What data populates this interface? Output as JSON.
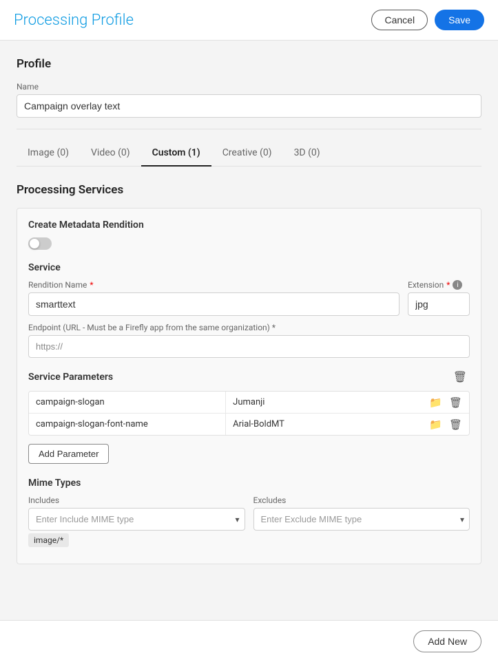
{
  "header": {
    "title_plain": "Processing",
    "title_accent": " Profile",
    "cancel_label": "Cancel",
    "save_label": "Save"
  },
  "profile_section": {
    "section_label": "Profile",
    "name_label": "Name",
    "name_value": "Campaign overlay text"
  },
  "tabs": [
    {
      "label": "Image (0)",
      "active": false
    },
    {
      "label": "Video (0)",
      "active": false
    },
    {
      "label": "Custom (1)",
      "active": true
    },
    {
      "label": "Creative (0)",
      "active": false
    },
    {
      "label": "3D (0)",
      "active": false
    }
  ],
  "processing_services": {
    "section_label": "Processing Services",
    "card_title": "Create Metadata Rendition",
    "service_label": "Service",
    "rendition_name_label": "Rendition Name",
    "rendition_name_required": "*",
    "rendition_name_value": "smarttext",
    "extension_label": "Extension",
    "extension_required": "*",
    "extension_value": "jpg",
    "endpoint_label": "Endpoint (URL - Must be a Firefly app from the same organization) *",
    "endpoint_value": "https://",
    "endpoint_placeholder": "https://",
    "params_title": "Service Parameters",
    "params": [
      {
        "key": "campaign-slogan",
        "value": "Jumanji"
      },
      {
        "key": "campaign-slogan-font-name",
        "value": "Arial-BoldMT"
      }
    ],
    "add_param_label": "Add Parameter"
  },
  "mime_types": {
    "section_label": "Mime Types",
    "includes_label": "Includes",
    "includes_placeholder": "Enter Include MIME type",
    "includes_tag": "image/*",
    "excludes_label": "Excludes",
    "excludes_placeholder": "Enter Exclude MIME type"
  },
  "footer": {
    "add_new_label": "Add New"
  },
  "icons": {
    "delete": "🗑",
    "folder": "📁",
    "chevron_down": "▾",
    "info": "i"
  }
}
